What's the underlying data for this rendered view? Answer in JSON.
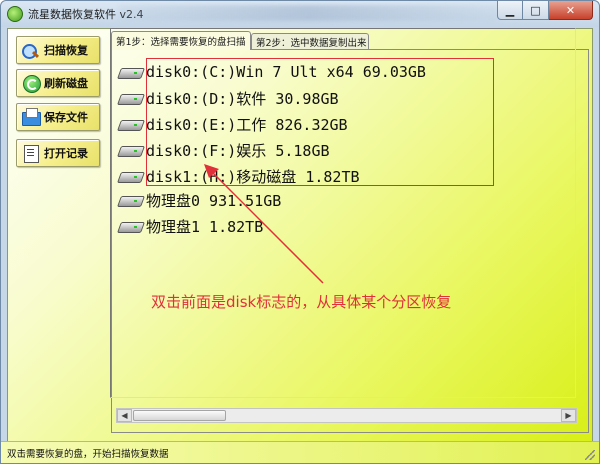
{
  "window": {
    "title": "流星数据恢复软件 v2.4",
    "minimize_glyph": "▁",
    "maximize_glyph": "□",
    "close_glyph": "✕"
  },
  "sidebar": {
    "buttons": [
      {
        "label": "扫描恢复",
        "icon": "magnifier-icon"
      },
      {
        "label": "刷新磁盘",
        "icon": "refresh-icon"
      },
      {
        "label": "保存文件",
        "icon": "save-icon"
      },
      {
        "label": "打开记录",
        "icon": "record-icon"
      }
    ]
  },
  "tabs": [
    {
      "label": "第1步：选择需要恢复的盘扫描",
      "active": true
    },
    {
      "label": "第2步：选中数据复制出来",
      "active": false
    }
  ],
  "disks": [
    {
      "label": "disk0:(C:)Win 7 Ult x64 69.03GB"
    },
    {
      "label": "disk0:(D:)软件 30.98GB"
    },
    {
      "label": "disk0:(E:)工作 826.32GB"
    },
    {
      "label": "disk0:(F:)娱乐 5.18GB"
    },
    {
      "label": "disk1:(H:)移动磁盘 1.82TB"
    },
    {
      "label": "物理盘0 931.51GB"
    },
    {
      "label": "物理盘1 1.82TB"
    }
  ],
  "annotation": {
    "text": "双击前面是disk标志的，从具体某个分区恢复",
    "color": "#e0303a"
  },
  "scrollbar": {
    "left_glyph": "◀",
    "right_glyph": "▶"
  },
  "status": {
    "text": "双击需要恢复的盘，开始扫描恢复数据"
  },
  "colors": {
    "accent_red": "#e0303a",
    "client_gradient_end": "#d8ef12"
  }
}
